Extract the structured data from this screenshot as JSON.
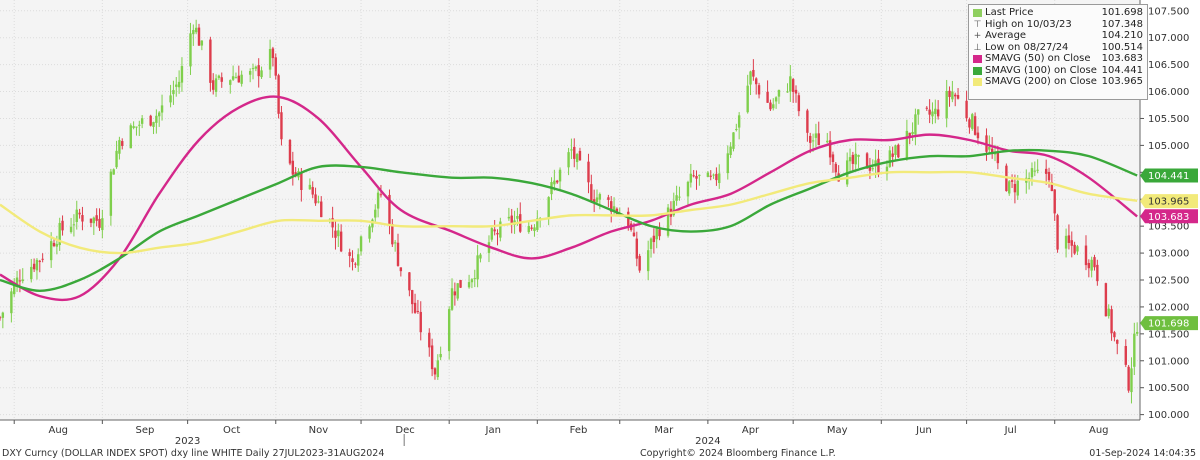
{
  "chart_data": {
    "type": "candlestick-line",
    "y_axis": {
      "min": 99.9,
      "max": 107.7,
      "side": "right",
      "ticks": [
        100.0,
        100.5,
        101.0,
        101.5,
        102.0,
        102.5,
        103.0,
        103.5,
        104.0,
        104.5,
        105.0,
        105.5,
        106.0,
        106.5,
        107.0,
        107.5
      ],
      "tick_labels": [
        "100.000",
        "100.500",
        "101.000",
        "101.500",
        "102.000",
        "102.500",
        "103.000",
        "103.500",
        "104.000",
        "104.500",
        "105.000",
        "105.500",
        "106.000",
        "106.500",
        "107.000",
        "107.500"
      ]
    },
    "x_axis": {
      "range": [
        "2023-07-27",
        "2024-08-31"
      ],
      "months": [
        {
          "label": "Aug",
          "date": "2023-08-01"
        },
        {
          "label": "Sep",
          "date": "2023-09-01"
        },
        {
          "label": "Oct",
          "date": "2023-10-01"
        },
        {
          "label": "Nov",
          "date": "2023-11-01"
        },
        {
          "label": "Dec",
          "date": "2023-12-01"
        },
        {
          "label": "Jan",
          "date": "2024-01-01"
        },
        {
          "label": "Feb",
          "date": "2024-02-01"
        },
        {
          "label": "Mar",
          "date": "2024-03-01"
        },
        {
          "label": "Apr",
          "date": "2024-04-01"
        },
        {
          "label": "May",
          "date": "2024-05-01"
        },
        {
          "label": "Jun",
          "date": "2024-06-01"
        },
        {
          "label": "Jul",
          "date": "2024-07-01"
        },
        {
          "label": "Aug",
          "date": "2024-08-01"
        }
      ],
      "years": [
        {
          "label": "2023",
          "date": "2023-10-01"
        },
        {
          "label": "2024",
          "date": "2024-04-01"
        }
      ]
    },
    "price": [
      [
        "2023-07-27",
        101.8
      ],
      [
        "2023-08-03",
        102.6
      ],
      [
        "2023-08-10",
        102.9
      ],
      [
        "2023-08-17",
        103.4
      ],
      [
        "2023-08-24",
        103.7
      ],
      [
        "2023-08-31",
        103.6
      ],
      [
        "2023-09-07",
        105.1
      ],
      [
        "2023-09-14",
        105.4
      ],
      [
        "2023-09-21",
        105.6
      ],
      [
        "2023-09-28",
        106.2
      ],
      [
        "2023-10-03",
        107.3
      ],
      [
        "2023-10-10",
        106.1
      ],
      [
        "2023-10-17",
        106.3
      ],
      [
        "2023-10-24",
        106.3
      ],
      [
        "2023-10-31",
        106.7
      ],
      [
        "2023-11-03",
        105.0
      ],
      [
        "2023-11-07",
        104.5
      ],
      [
        "2023-11-14",
        104.1
      ],
      [
        "2023-11-21",
        103.5
      ],
      [
        "2023-11-28",
        102.8
      ],
      [
        "2023-12-01",
        103.3
      ],
      [
        "2023-12-08",
        104.1
      ],
      [
        "2023-12-15",
        102.7
      ],
      [
        "2023-12-22",
        101.6
      ],
      [
        "2023-12-27",
        100.8
      ],
      [
        "2024-01-02",
        102.3
      ],
      [
        "2024-01-09",
        102.6
      ],
      [
        "2024-01-16",
        103.3
      ],
      [
        "2024-01-23",
        103.6
      ],
      [
        "2024-01-30",
        103.5
      ],
      [
        "2024-02-06",
        104.2
      ],
      [
        "2024-02-13",
        104.9
      ],
      [
        "2024-02-20",
        104.1
      ],
      [
        "2024-02-27",
        103.9
      ],
      [
        "2024-03-04",
        103.6
      ],
      [
        "2024-03-08",
        102.7
      ],
      [
        "2024-03-14",
        103.4
      ],
      [
        "2024-03-19",
        103.8
      ],
      [
        "2024-03-27",
        104.4
      ],
      [
        "2024-04-03",
        104.3
      ],
      [
        "2024-04-10",
        105.2
      ],
      [
        "2024-04-16",
        106.3
      ],
      [
        "2024-04-23",
        105.7
      ],
      [
        "2024-04-30",
        106.2
      ],
      [
        "2024-05-06",
        105.1
      ],
      [
        "2024-05-13",
        105.1
      ],
      [
        "2024-05-17",
        104.5
      ],
      [
        "2024-05-24",
        104.7
      ],
      [
        "2024-05-31",
        104.6
      ],
      [
        "2024-06-07",
        104.9
      ],
      [
        "2024-06-14",
        105.5
      ],
      [
        "2024-06-20",
        105.6
      ],
      [
        "2024-06-26",
        106.0
      ],
      [
        "2024-07-02",
        105.5
      ],
      [
        "2024-07-09",
        104.9
      ],
      [
        "2024-07-16",
        104.2
      ],
      [
        "2024-07-23",
        104.4
      ],
      [
        "2024-07-30",
        104.5
      ],
      [
        "2024-08-02",
        103.2
      ],
      [
        "2024-08-08",
        103.1
      ],
      [
        "2024-08-15",
        102.8
      ],
      [
        "2024-08-22",
        101.4
      ],
      [
        "2024-08-27",
        100.6
      ],
      [
        "2024-08-30",
        101.7
      ]
    ],
    "series": [
      {
        "name": "SMAVG (50)",
        "color": "#d4278a",
        "points": [
          [
            "2023-07-27",
            102.6
          ],
          [
            "2023-08-10",
            102.2
          ],
          [
            "2023-08-24",
            102.2
          ],
          [
            "2023-09-07",
            102.9
          ],
          [
            "2023-09-21",
            104.1
          ],
          [
            "2023-10-05",
            105.1
          ],
          [
            "2023-10-19",
            105.7
          ],
          [
            "2023-11-02",
            105.9
          ],
          [
            "2023-11-16",
            105.5
          ],
          [
            "2023-12-01",
            104.6
          ],
          [
            "2023-12-15",
            103.8
          ],
          [
            "2024-01-02",
            103.4
          ],
          [
            "2024-01-16",
            103.1
          ],
          [
            "2024-01-30",
            102.9
          ],
          [
            "2024-02-13",
            103.1
          ],
          [
            "2024-02-27",
            103.4
          ],
          [
            "2024-03-12",
            103.6
          ],
          [
            "2024-03-26",
            103.9
          ],
          [
            "2024-04-09",
            104.1
          ],
          [
            "2024-04-23",
            104.5
          ],
          [
            "2024-05-07",
            104.9
          ],
          [
            "2024-05-21",
            105.1
          ],
          [
            "2024-06-04",
            105.1
          ],
          [
            "2024-06-18",
            105.2
          ],
          [
            "2024-07-02",
            105.1
          ],
          [
            "2024-07-16",
            104.9
          ],
          [
            "2024-07-30",
            104.8
          ],
          [
            "2024-08-13",
            104.4
          ],
          [
            "2024-08-30",
            103.68
          ]
        ]
      },
      {
        "name": "SMAVG (100)",
        "color": "#3aa83a",
        "points": [
          [
            "2023-07-27",
            102.5
          ],
          [
            "2023-08-10",
            102.3
          ],
          [
            "2023-08-24",
            102.5
          ],
          [
            "2023-09-07",
            102.9
          ],
          [
            "2023-09-21",
            103.4
          ],
          [
            "2023-10-05",
            103.7
          ],
          [
            "2023-10-19",
            104.0
          ],
          [
            "2023-11-02",
            104.3
          ],
          [
            "2023-11-16",
            104.6
          ],
          [
            "2023-12-01",
            104.6
          ],
          [
            "2023-12-15",
            104.5
          ],
          [
            "2024-01-02",
            104.4
          ],
          [
            "2024-01-16",
            104.4
          ],
          [
            "2024-01-30",
            104.3
          ],
          [
            "2024-02-13",
            104.1
          ],
          [
            "2024-02-27",
            103.8
          ],
          [
            "2024-03-12",
            103.5
          ],
          [
            "2024-03-26",
            103.4
          ],
          [
            "2024-04-09",
            103.5
          ],
          [
            "2024-04-23",
            103.9
          ],
          [
            "2024-05-07",
            104.2
          ],
          [
            "2024-05-21",
            104.5
          ],
          [
            "2024-06-04",
            104.7
          ],
          [
            "2024-06-18",
            104.8
          ],
          [
            "2024-07-02",
            104.8
          ],
          [
            "2024-07-16",
            104.9
          ],
          [
            "2024-07-30",
            104.9
          ],
          [
            "2024-08-13",
            104.8
          ],
          [
            "2024-08-30",
            104.44
          ]
        ]
      },
      {
        "name": "SMAVG (200)",
        "color": "#f2ea7a",
        "points": [
          [
            "2023-07-27",
            103.9
          ],
          [
            "2023-08-10",
            103.4
          ],
          [
            "2023-08-24",
            103.1
          ],
          [
            "2023-09-07",
            103.0
          ],
          [
            "2023-09-21",
            103.1
          ],
          [
            "2023-10-05",
            103.2
          ],
          [
            "2023-10-19",
            103.4
          ],
          [
            "2023-11-02",
            103.6
          ],
          [
            "2023-11-16",
            103.6
          ],
          [
            "2023-12-01",
            103.6
          ],
          [
            "2023-12-15",
            103.5
          ],
          [
            "2024-01-02",
            103.5
          ],
          [
            "2024-01-16",
            103.5
          ],
          [
            "2024-01-30",
            103.6
          ],
          [
            "2024-02-13",
            103.7
          ],
          [
            "2024-02-27",
            103.7
          ],
          [
            "2024-03-12",
            103.7
          ],
          [
            "2024-03-26",
            103.8
          ],
          [
            "2024-04-09",
            103.9
          ],
          [
            "2024-04-23",
            104.1
          ],
          [
            "2024-05-07",
            104.3
          ],
          [
            "2024-05-21",
            104.4
          ],
          [
            "2024-06-04",
            104.5
          ],
          [
            "2024-06-18",
            104.5
          ],
          [
            "2024-07-02",
            104.5
          ],
          [
            "2024-07-16",
            104.4
          ],
          [
            "2024-07-30",
            104.3
          ],
          [
            "2024-08-13",
            104.1
          ],
          [
            "2024-08-30",
            103.97
          ]
        ]
      }
    ],
    "last_value_tags": [
      {
        "value": 104.441,
        "label": "104.441",
        "color": "#3aa83a",
        "text_color": "#ffffff"
      },
      {
        "value": 103.965,
        "label": "103.965",
        "color": "#f2ea7a",
        "text_color": "#333333"
      },
      {
        "value": 103.683,
        "label": "103.683",
        "color": "#d4278a",
        "text_color": "#ffffff"
      },
      {
        "value": 101.698,
        "label": "101.698",
        "color": "#6fbf3f",
        "text_color": "#ffffff"
      }
    ],
    "colors": {
      "up": "#7fcf4c",
      "down": "#dd3c4c",
      "grid": "#dcdcdc",
      "axis_text": "#333333"
    },
    "grid": true,
    "legend": {
      "placement": "top-right",
      "entries": [
        {
          "symbol": "square",
          "color": "#8fcf5f",
          "label": "Last Price",
          "value": "101.698"
        },
        {
          "symbol": "high-icon",
          "color": "#555555",
          "label": "High on 10/03/23",
          "value": "107.348"
        },
        {
          "symbol": "average-icon",
          "color": "#555555",
          "label": "Average",
          "value": "104.210"
        },
        {
          "symbol": "low-icon",
          "color": "#555555",
          "label": "Low on 08/27/24",
          "value": "100.514"
        },
        {
          "symbol": "square",
          "color": "#d4278a",
          "label": "SMAVG (50)  on Close",
          "value": "103.683"
        },
        {
          "symbol": "square",
          "color": "#3aa83a",
          "label": "SMAVG (100)  on Close",
          "value": "104.441"
        },
        {
          "symbol": "square",
          "color": "#f2ea7a",
          "label": "SMAVG (200)  on Close",
          "value": "103.965"
        }
      ]
    }
  },
  "footer": {
    "left": "DXY Curncy (DOLLAR INDEX SPOT) dxy line WHITE  Daily 27JUL2023-31AUG2024",
    "center": "Copyright© 2024 Bloomberg Finance L.P.",
    "right": "01-Sep-2024 14:04:35"
  }
}
